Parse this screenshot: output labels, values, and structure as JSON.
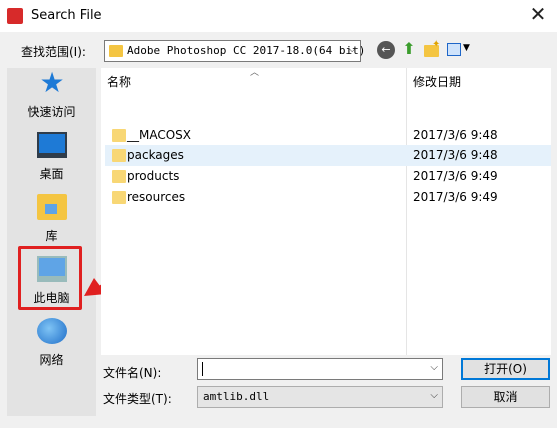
{
  "window": {
    "title": "Search File",
    "close": "✕"
  },
  "toolbar": {
    "look_in_label": "查找范围(I):",
    "look_in_value": "Adobe Photoshop CC 2017-18.0(64 bit)",
    "back_icon": "back-icon",
    "up_icon": "up-folder-icon",
    "new_folder_icon": "new-folder-icon",
    "view_menu_icon": "view-menu-icon"
  },
  "places": [
    {
      "label": "快速访问",
      "icon": "quick-access-icon"
    },
    {
      "label": "桌面",
      "icon": "desktop-icon"
    },
    {
      "label": "库",
      "icon": "library-icon"
    },
    {
      "label": "此电脑",
      "icon": "this-pc-icon"
    },
    {
      "label": "网络",
      "icon": "network-icon"
    }
  ],
  "file_list": {
    "headers": {
      "name": "名称",
      "date": "修改日期"
    },
    "rows": [
      {
        "name": "__MACOSX",
        "date": "2017/3/6 9:48",
        "selected": false
      },
      {
        "name": "packages",
        "date": "2017/3/6 9:48",
        "selected": true
      },
      {
        "name": "products",
        "date": "2017/3/6 9:49",
        "selected": false
      },
      {
        "name": "resources",
        "date": "2017/3/6 9:49",
        "selected": false
      }
    ]
  },
  "form": {
    "filename_label": "文件名(N):",
    "filename_value": "",
    "filetype_label": "文件类型(T):",
    "filetype_value": "amtlib.dll"
  },
  "buttons": {
    "open": "打开(O)",
    "cancel": "取消"
  },
  "annotation": {
    "color": "#e02020"
  }
}
